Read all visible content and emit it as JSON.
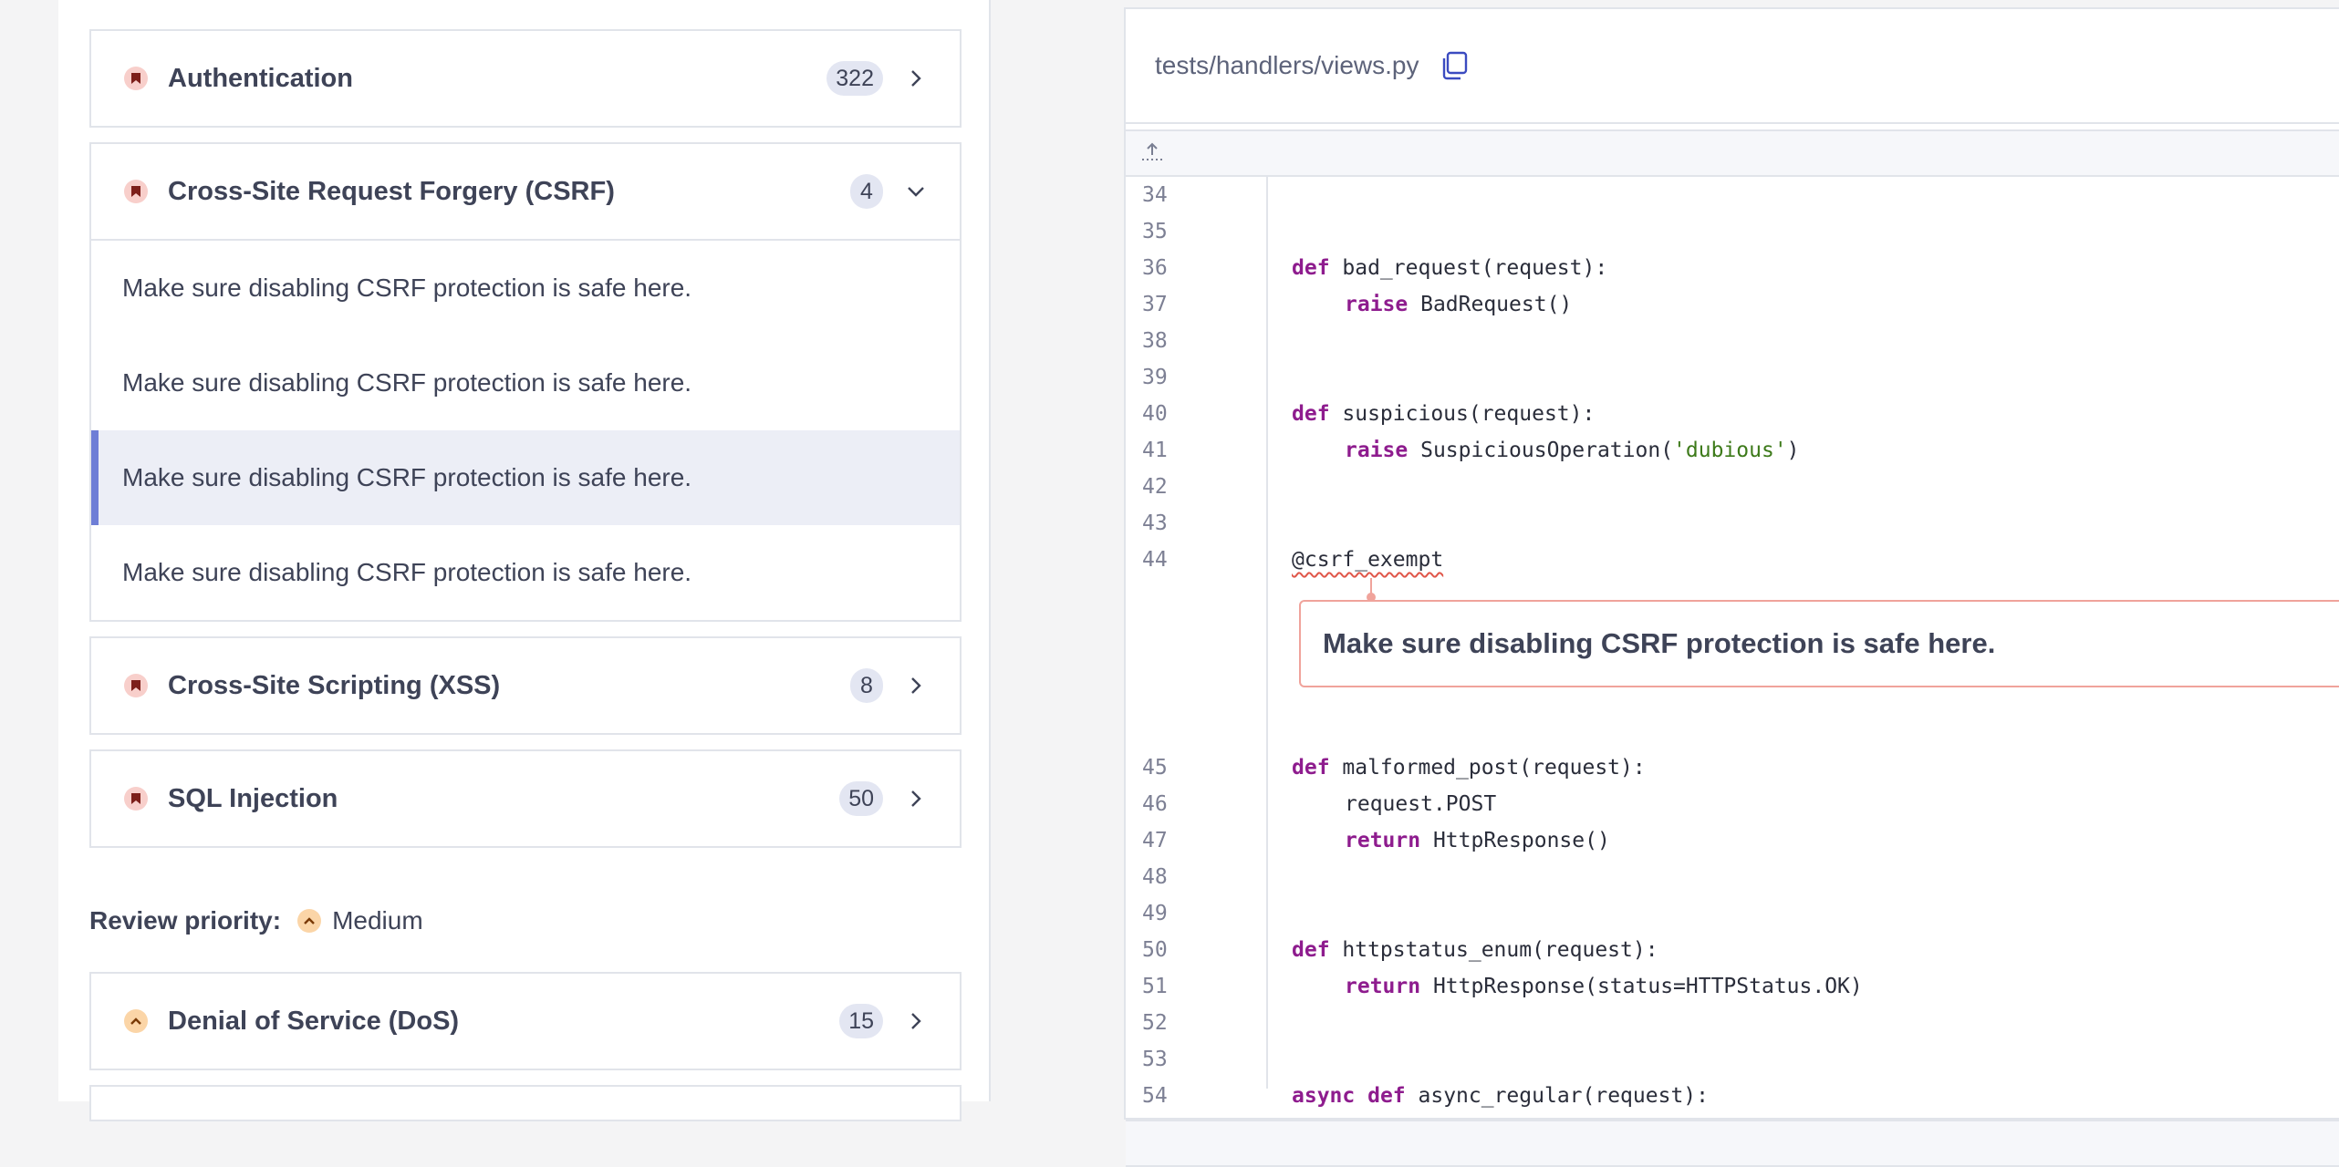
{
  "categories_high": [
    {
      "title": "Authentication",
      "count": "322"
    },
    {
      "title": "Cross-Site Request Forgery (CSRF)",
      "count": "4",
      "hotspots": [
        "Make sure disabling CSRF protection is safe here.",
        "Make sure disabling CSRF protection is safe here.",
        "Make sure disabling CSRF protection is safe here.",
        "Make sure disabling CSRF protection is safe here."
      ]
    },
    {
      "title": "Cross-Site Scripting (XSS)",
      "count": "8"
    },
    {
      "title": "SQL Injection",
      "count": "50"
    }
  ],
  "review_priority": {
    "label": "Review priority:",
    "value": "Medium"
  },
  "categories_medium": [
    {
      "title": "Denial of Service (DoS)",
      "count": "15"
    }
  ],
  "file": {
    "path": "tests/handlers/views.py"
  },
  "code": {
    "lines": {
      "l34": "34",
      "l35": "35",
      "l36": "36",
      "l37": "37",
      "l38": "38",
      "l39": "39",
      "l40": "40",
      "l41": "41",
      "l42": "42",
      "l43": "43",
      "l44": "44",
      "l45": "45",
      "l46": "46",
      "l47": "47",
      "l48": "48",
      "l49": "49",
      "l50": "50",
      "l51": "51",
      "l52": "52",
      "l53": "53",
      "l54": "54"
    },
    "kw_def": "def",
    "kw_raise": "raise",
    "kw_return": "return",
    "kw_async": "async",
    "c36": " bad_request(request):",
    "c37": " BadRequest()",
    "c40": " suspicious(request):",
    "c41a": " SuspiciousOperation(",
    "c41s": "'dubious'",
    "c41b": ")",
    "c44": "@csrf_exempt",
    "c45": " malformed_post(request):",
    "c46": "request.POST",
    "c47": " HttpResponse()",
    "c50": " httpstatus_enum(request):",
    "c51": " HttpResponse(status=HTTPStatus.OK)",
    "c54": " async_regular(request):"
  },
  "issue": {
    "message": "Make sure disabling CSRF protection is safe here."
  },
  "colors": {
    "high_risk": "#f8cfcb",
    "medium_risk": "#fbd5a7",
    "selected_bar": "#6e7ed6",
    "keyword": "#8e1c8e",
    "string": "#3d7a1a"
  }
}
